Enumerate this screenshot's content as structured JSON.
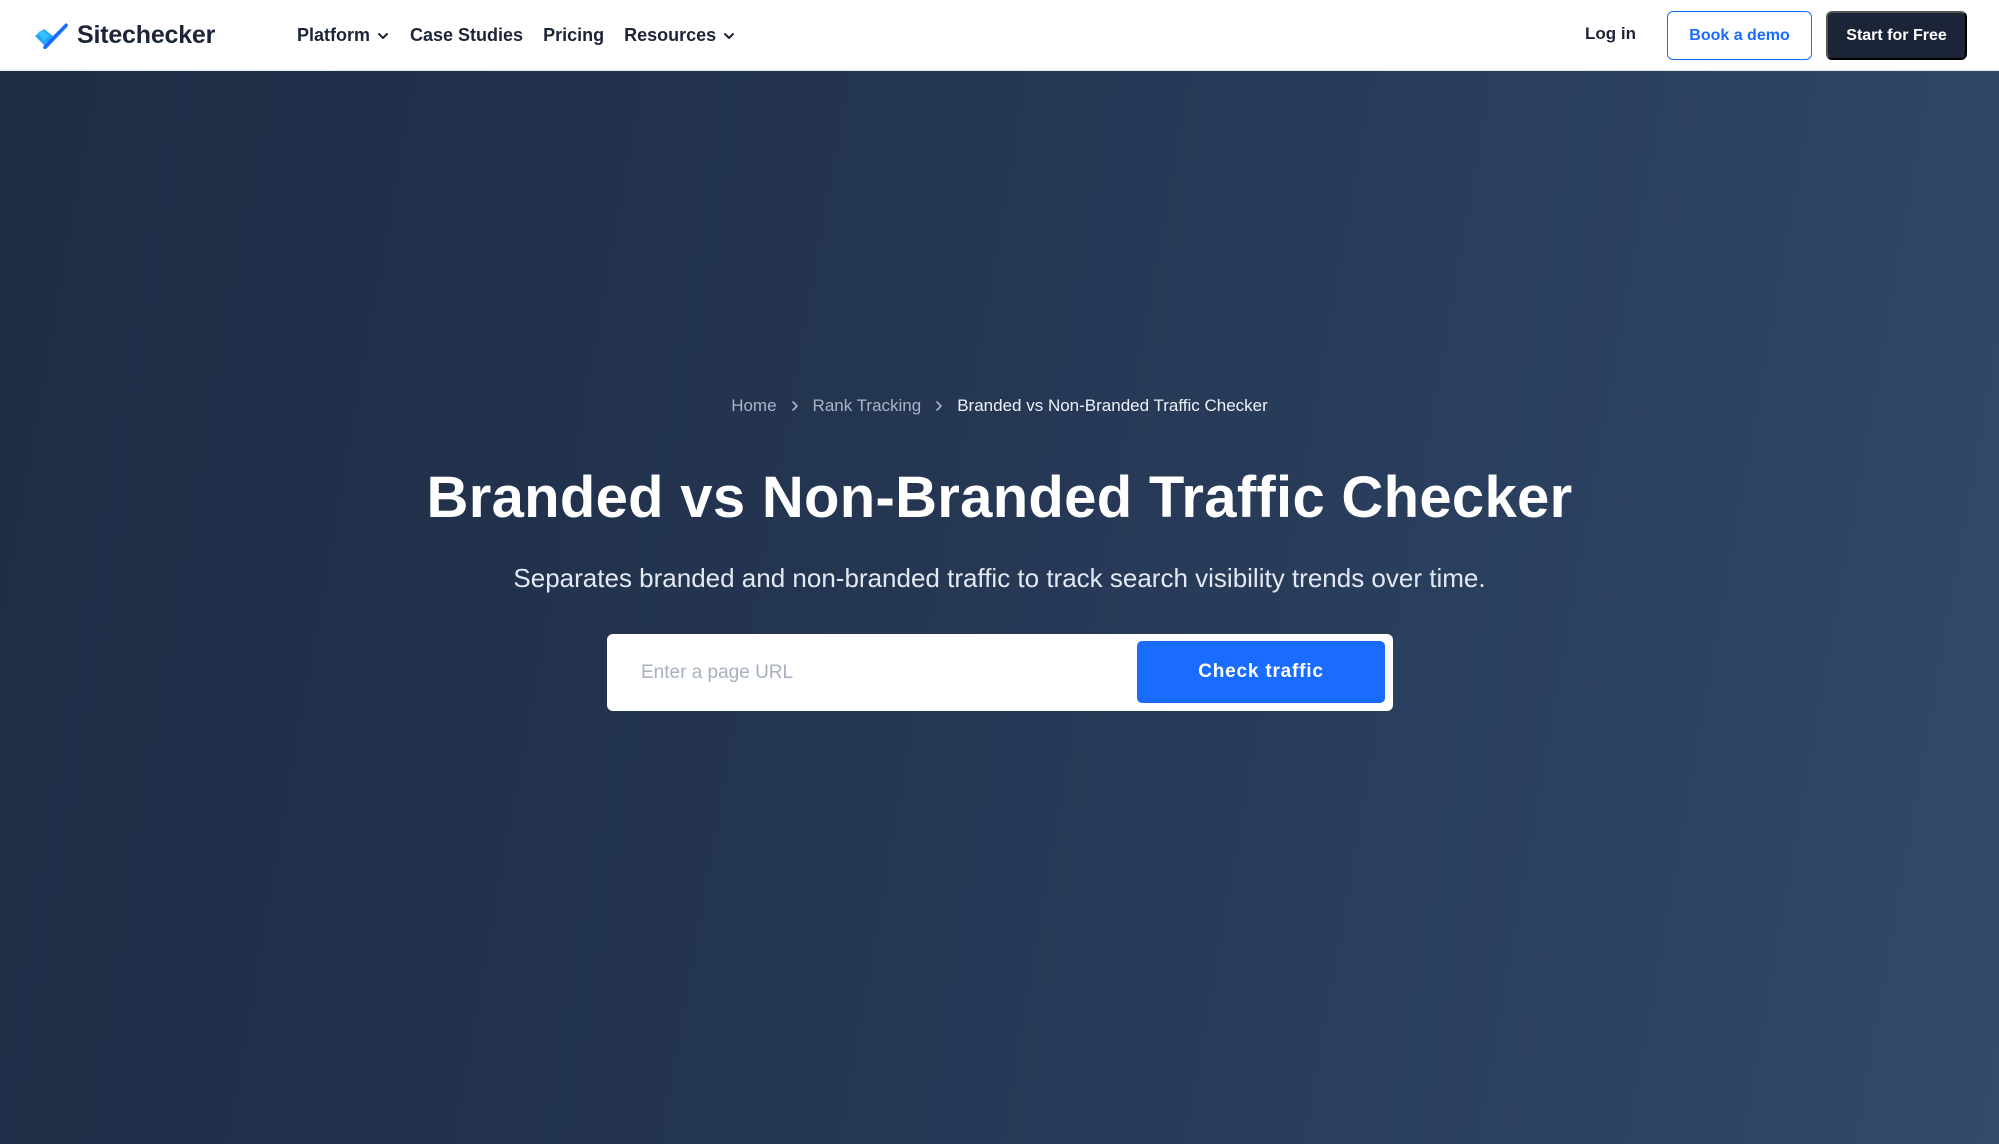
{
  "brand": {
    "name": "Sitechecker",
    "logo_colors": [
      "#1fa8f5",
      "#1a6bff"
    ]
  },
  "nav": {
    "items": [
      {
        "label": "Platform",
        "has_dropdown": true
      },
      {
        "label": "Case Studies",
        "has_dropdown": false
      },
      {
        "label": "Pricing",
        "has_dropdown": false
      },
      {
        "label": "Resources",
        "has_dropdown": true
      }
    ],
    "login_label": "Log in",
    "demo_label": "Book a demo",
    "start_label": "Start for Free"
  },
  "breadcrumb": {
    "items": [
      "Home",
      "Rank Tracking"
    ],
    "current": "Branded vs Non-Branded Traffic Checker"
  },
  "hero": {
    "title": "Branded vs Non-Branded Traffic Checker",
    "subtitle": "Separates branded and non-branded traffic to track search visibility trends over time.",
    "input_placeholder": "Enter a page URL",
    "input_value": "",
    "button_label": "Check traffic"
  },
  "colors": {
    "accent": "#1a6bff",
    "dark": "#1c2538",
    "hero_bg_start": "#1e2c45",
    "hero_bg_end": "#334a6a"
  }
}
